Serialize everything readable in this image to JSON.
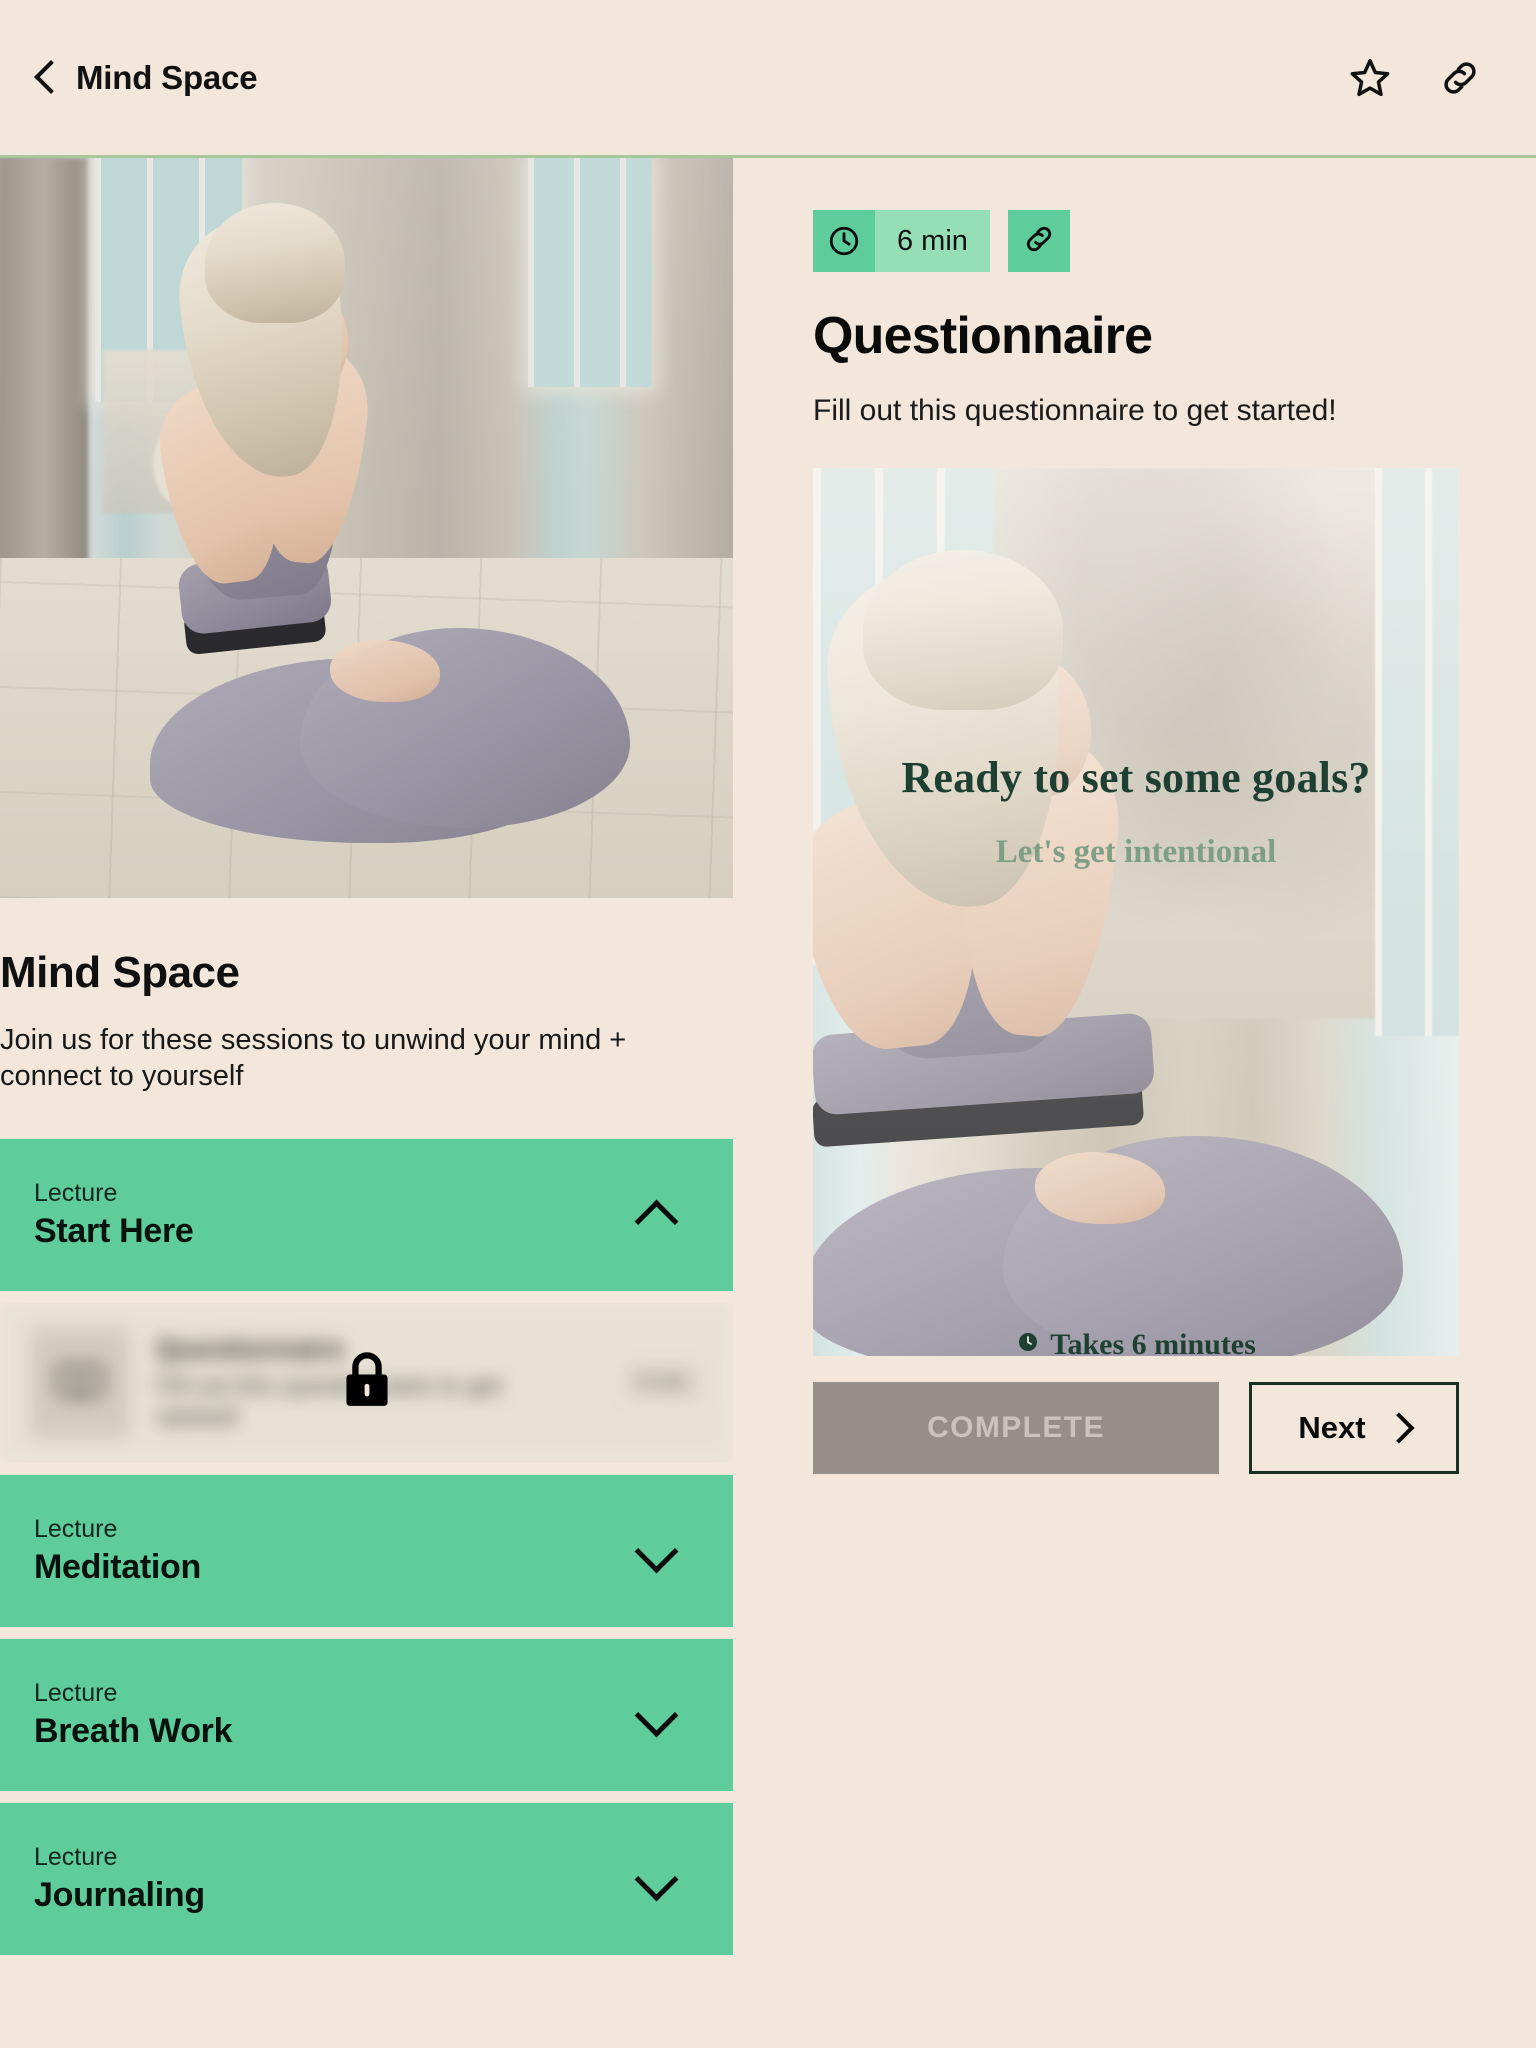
{
  "topbar": {
    "back_label": "Mind Space",
    "back_icon": "chevron-left-icon",
    "favorite_icon": "star-outline-icon",
    "share_icon": "link-icon"
  },
  "course": {
    "hero_image_alt": "Woman meditating in seated pose outdoors",
    "title": "Mind Space",
    "description": "Join us for these sessions to unwind your mind + connect to yourself",
    "sections": [
      {
        "kicker": "Lecture",
        "name": "Start Here",
        "expanded": true,
        "chevron": "chevron-up-icon"
      },
      {
        "kicker": "Lecture",
        "name": "Meditation",
        "expanded": false,
        "chevron": "chevron-down-icon"
      },
      {
        "kicker": "Lecture",
        "name": "Breath Work",
        "expanded": false,
        "chevron": "chevron-down-icon"
      },
      {
        "kicker": "Lecture",
        "name": "Journaling",
        "expanded": false,
        "chevron": "chevron-down-icon"
      }
    ],
    "locked_lesson": {
      "thumb_icon": "book-icon",
      "title": "Questionnaire",
      "description": "Fill out this questionnaire to get started!",
      "duration": "6 min",
      "lock_icon": "lock-icon",
      "locked": true
    }
  },
  "lesson": {
    "clock_icon": "clock-icon",
    "duration": "6 min",
    "share_icon": "link-icon",
    "title": "Questionnaire",
    "subtitle": "Fill out this questionnaire to get started!",
    "slide": {
      "image_alt": "Woman meditating with hands in prayer pose",
      "headline": "Ready to set some goals?",
      "subhead": "Let's get intentional",
      "footer_icon": "clock-icon",
      "footer_text": "Takes 6 minutes"
    },
    "complete_label": "COMPLETE",
    "complete_disabled": true,
    "next_label": "Next",
    "next_icon": "chevron-right-icon"
  },
  "colors": {
    "background": "#F2E7DA",
    "accent_green": "#5FCC9B",
    "accent_green_light": "#96DEB6",
    "divider_green": "#A8C79A",
    "disabled_gray": "#968F88",
    "disabled_text": "#C9C3BC",
    "dark_green": "#1E4032",
    "sage_green": "#7E9E86",
    "text_dark": "#0B0B0B"
  }
}
